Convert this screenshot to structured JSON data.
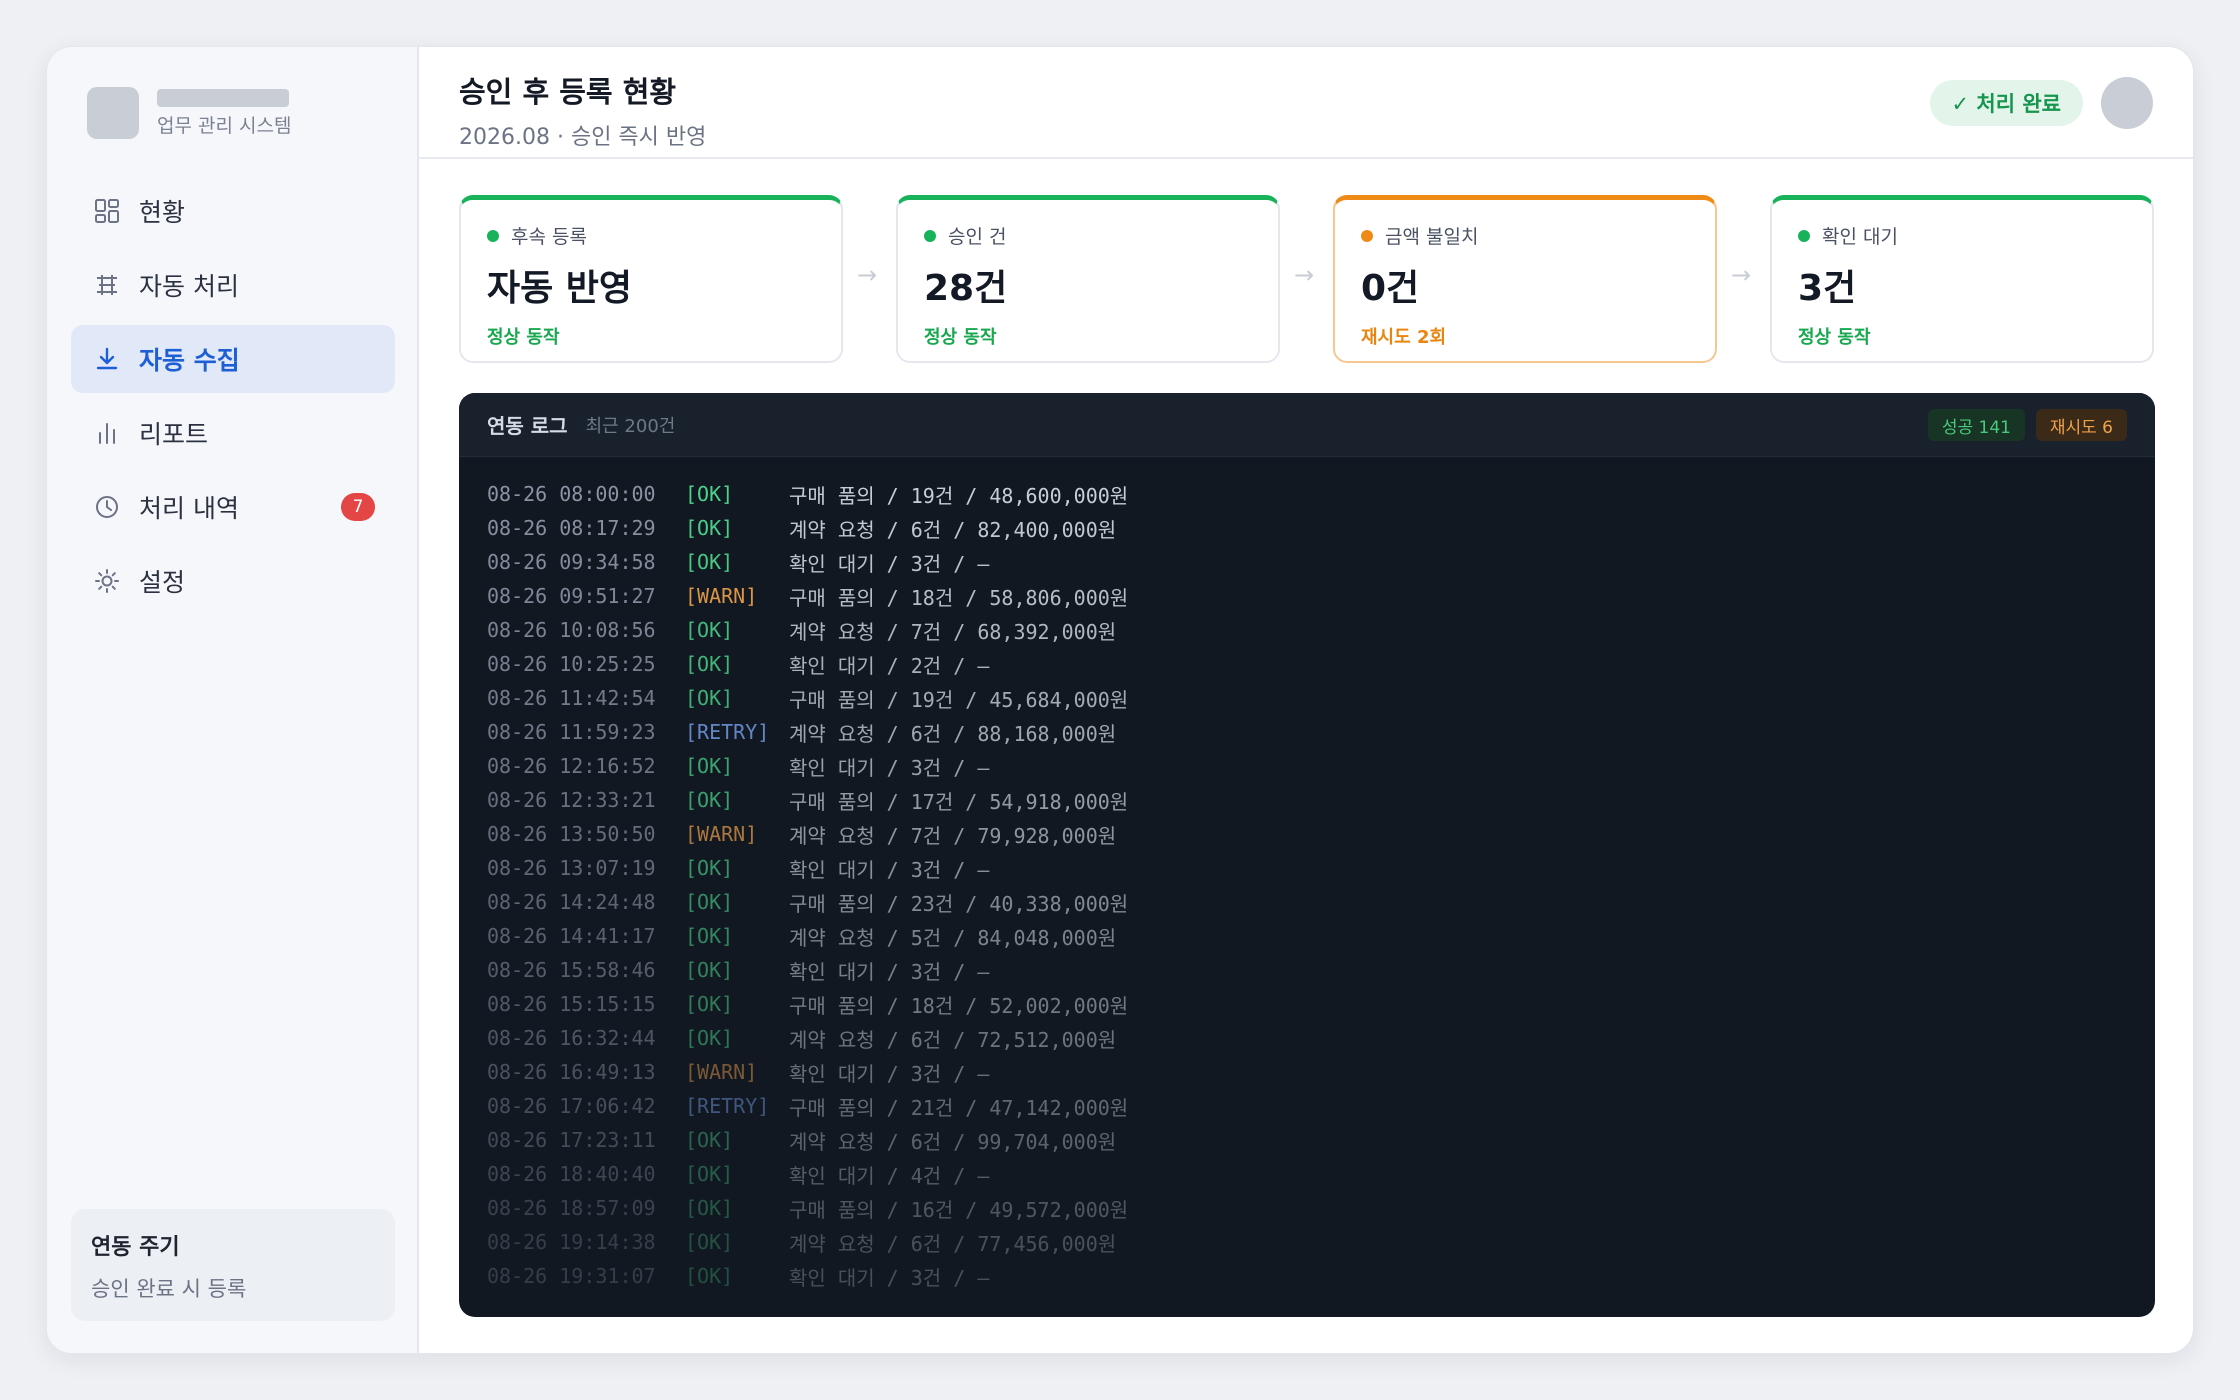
{
  "sidebar": {
    "brand_sub": "업무 관리 시스템",
    "items": [
      {
        "label": "현황",
        "icon": "dashboard-grid-icon"
      },
      {
        "label": "자동 처리",
        "icon": "table-icon"
      },
      {
        "label": "자동 수집",
        "icon": "download-icon",
        "active": true
      },
      {
        "label": "리포트",
        "icon": "bar-chart-icon"
      },
      {
        "label": "처리 내역",
        "icon": "clock-icon",
        "badge": "7"
      },
      {
        "label": "설정",
        "icon": "gear-icon"
      }
    ],
    "cycle_title": "연동 주기",
    "cycle_sub": "승인 완료 시 등록"
  },
  "header": {
    "title": "승인 후 등록 현황",
    "subtitle": "2026.08 · 승인 즉시 반영",
    "status_badge": "✓ 처리 완료"
  },
  "cards": [
    {
      "label": "후속 등록",
      "value": "자동 반영",
      "status": "정상 동작",
      "state": "ok"
    },
    {
      "label": "승인 건",
      "value": "28건",
      "status": "정상 동작",
      "state": "ok"
    },
    {
      "label": "금액 불일치",
      "value": "0건",
      "status": "재시도 2회",
      "state": "warn"
    },
    {
      "label": "확인 대기",
      "value": "3건",
      "status": "정상 동작",
      "state": "ok"
    }
  ],
  "flow_arrow": "→",
  "log": {
    "title": "연동 로그",
    "subtitle": "최근 200건",
    "success_pill": "성공 141",
    "retry_pill": "재시도 6",
    "lines": [
      {
        "time": "08-26 08:00:00",
        "level": "[OK]",
        "msg": "구매 품의 / 19건 / 48,600,000원"
      },
      {
        "time": "08-26 08:17:29",
        "level": "[OK]",
        "msg": "계약 요청 / 6건 / 82,400,000원"
      },
      {
        "time": "08-26 09:34:58",
        "level": "[OK]",
        "msg": "확인 대기 / 3건 / —"
      },
      {
        "time": "08-26 09:51:27",
        "level": "[WARN]",
        "msg": "구매 품의 / 18건 / 58,806,000원"
      },
      {
        "time": "08-26 10:08:56",
        "level": "[OK]",
        "msg": "계약 요청 / 7건 / 68,392,000원"
      },
      {
        "time": "08-26 10:25:25",
        "level": "[OK]",
        "msg": "확인 대기 / 2건 / —"
      },
      {
        "time": "08-26 11:42:54",
        "level": "[OK]",
        "msg": "구매 품의 / 19건 / 45,684,000원"
      },
      {
        "time": "08-26 11:59:23",
        "level": "[RETRY]",
        "msg": "계약 요청 / 6건 / 88,168,000원"
      },
      {
        "time": "08-26 12:16:52",
        "level": "[OK]",
        "msg": "확인 대기 / 3건 / —"
      },
      {
        "time": "08-26 12:33:21",
        "level": "[OK]",
        "msg": "구매 품의 / 17건 / 54,918,000원"
      },
      {
        "time": "08-26 13:50:50",
        "level": "[WARN]",
        "msg": "계약 요청 / 7건 / 79,928,000원"
      },
      {
        "time": "08-26 13:07:19",
        "level": "[OK]",
        "msg": "확인 대기 / 3건 / —"
      },
      {
        "time": "08-26 14:24:48",
        "level": "[OK]",
        "msg": "구매 품의 / 23건 / 40,338,000원"
      },
      {
        "time": "08-26 14:41:17",
        "level": "[OK]",
        "msg": "계약 요청 / 5건 / 84,048,000원"
      },
      {
        "time": "08-26 15:58:46",
        "level": "[OK]",
        "msg": "확인 대기 / 3건 / —"
      },
      {
        "time": "08-26 15:15:15",
        "level": "[OK]",
        "msg": "구매 품의 / 18건 / 52,002,000원"
      },
      {
        "time": "08-26 16:32:44",
        "level": "[OK]",
        "msg": "계약 요청 / 6건 / 72,512,000원"
      },
      {
        "time": "08-26 16:49:13",
        "level": "[WARN]",
        "msg": "확인 대기 / 3건 / —"
      },
      {
        "time": "08-26 17:06:42",
        "level": "[RETRY]",
        "msg": "구매 품의 / 21건 / 47,142,000원"
      },
      {
        "time": "08-26 17:23:11",
        "level": "[OK]",
        "msg": "계약 요청 / 6건 / 99,704,000원"
      },
      {
        "time": "08-26 18:40:40",
        "level": "[OK]",
        "msg": "확인 대기 / 4건 / —"
      },
      {
        "time": "08-26 18:57:09",
        "level": "[OK]",
        "msg": "구매 품의 / 16건 / 49,572,000원"
      },
      {
        "time": "08-26 19:14:38",
        "level": "[OK]",
        "msg": "계약 요청 / 6건 / 77,456,000원"
      },
      {
        "time": "08-26 19:31:07",
        "level": "[OK]",
        "msg": "확인 대기 / 3건 / —"
      }
    ]
  },
  "colors": {
    "accent": "#1f5fd6",
    "ok": "#18b25a",
    "warn": "#f08a17",
    "log_bg": "#111821"
  }
}
